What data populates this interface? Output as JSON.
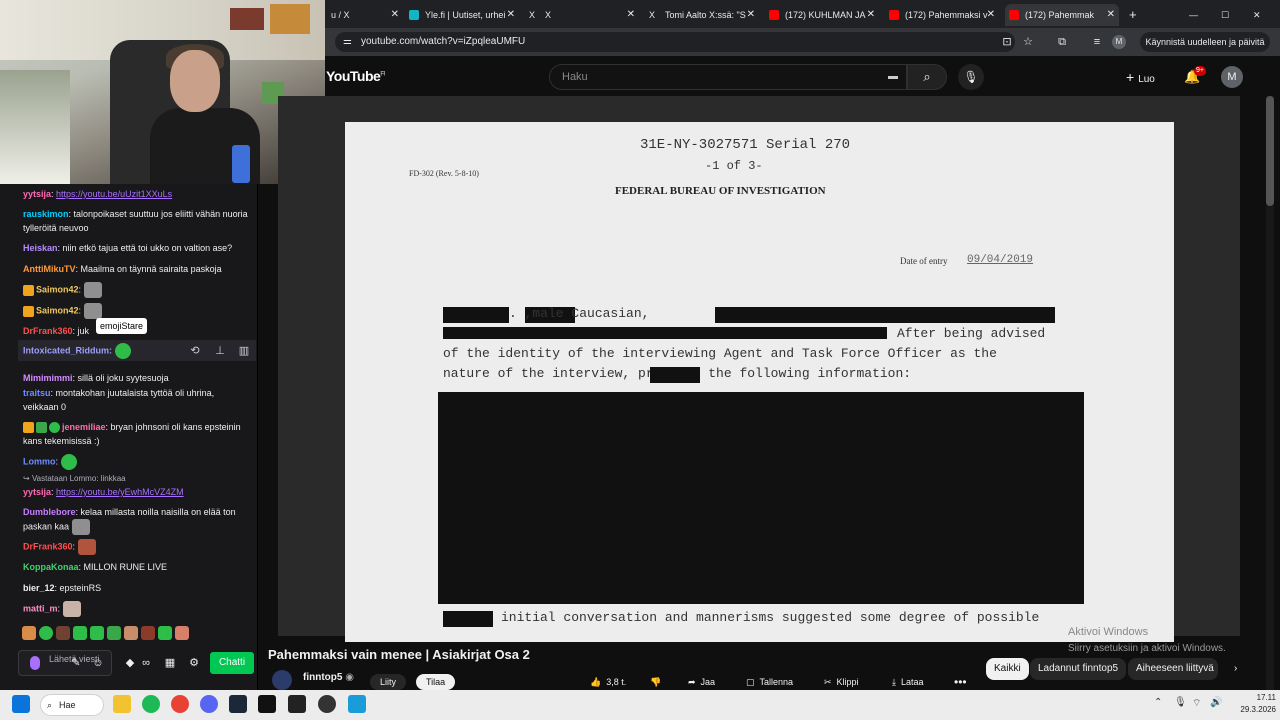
{
  "browser": {
    "tabs": [
      {
        "label": "u / X",
        "icon": "x-icon"
      },
      {
        "label": "Yle.fi | Uutiset, urhei",
        "icon": "yle-icon"
      },
      {
        "label": "X",
        "icon": "x-icon"
      },
      {
        "label": "Tomi Aalto X:ssä: \"S",
        "icon": "x-icon"
      },
      {
        "label": "(172) KUHLMAN JA",
        "icon": "youtube-icon"
      },
      {
        "label": "(172) Pahemmaksi v",
        "icon": "youtube-icon"
      },
      {
        "label": "(172) Pahemmak",
        "icon": "youtube-icon",
        "active": true
      }
    ],
    "url": "youtube.com/watch?v=iZpqleaUMFU",
    "relaunch_label": "Käynnistä uudelleen ja päivitä",
    "profile_initial": "M"
  },
  "youtube": {
    "logo": "YouTube",
    "logo_region": "FI",
    "search_placeholder": "Haku",
    "create_label": "Luo",
    "notifications": "9+",
    "avatar_initial": "M",
    "video_title": "Pahemmaksi vain menee | Asiakirjat Osa 2",
    "channel": "finntop5",
    "join_label": "Liity",
    "subscribe_label": "Tilaa",
    "likes": "3,8 t.",
    "share_label": "Jaa",
    "save_label": "Tallenna",
    "clip_label": "Klippi",
    "download_label": "Lataa",
    "chips": [
      "Kaikki",
      "Ladannut finntop5",
      "Aiheeseen liittyvä"
    ],
    "watermark_title": "Aktivoi Windows",
    "watermark_sub": "Siirry asetuksiin ja aktivoi Windows."
  },
  "document": {
    "serial": "31E-NY-3027571 Serial 270",
    "page": "-1 of 3-",
    "form": "FD-302 (Rev. 5-8-10)",
    "agency": "FEDERAL BUREAU OF INVESTIGATION",
    "date_label": "Date of entry",
    "date_value": "09/04/2019",
    "line1": ".        ,male Caucasian,",
    "line2": "After being advised",
    "line3": "of the identity of the interviewing Agent and Task Force Officer as the",
    "line4": "nature of the interview,        provided the following information:",
    "line5": "initial conversation and mannerisms suggested some degree of possible"
  },
  "chat": {
    "messages": [
      {
        "user": "yytsija",
        "color": "#ff69b4",
        "text": "https://youtu.be/uUzit1XXuLs",
        "link": true
      },
      {
        "user": "rauskimon",
        "color": "#00d1ff",
        "text": "talonpoikaset suuttuu jos eliitti vähän nuoria tylleröitä neuvoo"
      },
      {
        "user": "Heiskan",
        "color": "#b48cff",
        "text": "niin etkö tajua että toi ukko on valtion ase?"
      },
      {
        "user": "AnttiMikuTV",
        "color": "#ff9a3c",
        "text": "Maailma on täynnä sairaita paskoja"
      },
      {
        "user": "Saimon42",
        "color": "#f0c75e",
        "text": ""
      },
      {
        "user": "Saimon42",
        "color": "#f0c75e",
        "text": ""
      },
      {
        "user": "DrFrank360",
        "color": "#ff4f4f",
        "text": "juk"
      },
      {
        "user": "Intoxicated_Riddum",
        "color": "#9e9eff",
        "text": ""
      },
      {
        "user": "Mimimimmi",
        "color": "#d28cff",
        "text": "sillä oli joku syytesuoja"
      },
      {
        "user": "traitsu",
        "color": "#6f8cff",
        "text": "montakohan juutalaista tyttöä oli uhrina, veikkaan 0"
      },
      {
        "user": "jenemiliae",
        "color": "#ff6ea8",
        "text": "bryan johnsoni oli kans epsteinin kans tekemisissä :)"
      },
      {
        "user": "Lommo",
        "color": "#6f8cff",
        "text": ""
      },
      {
        "user": "yytsija",
        "color": "#ff69b4",
        "text": "https://youtu.be/yEwhMcVZ4ZM",
        "link": true
      },
      {
        "user": "Dumblebore",
        "color": "#c77dff",
        "text": "kelaa millasta noilla naisilla on elää ton paskan kaa"
      },
      {
        "user": "DrFrank360",
        "color": "#ff4f4f",
        "text": ""
      },
      {
        "user": "KoppaKonaa",
        "color": "#3cd46a",
        "text": "MILLON RUNE LIVE"
      },
      {
        "user": "bier_12",
        "color": "#efeff1",
        "text": "epsteinRS"
      },
      {
        "user": "matti_m",
        "color": "#ff8cc8",
        "text": ""
      }
    ],
    "reply_hint": "Vastataan Lommo: linkkaa",
    "tooltip": "emojiStare",
    "input_placeholder": "Lähetä viesti",
    "send_label": "Chatti"
  },
  "taskbar": {
    "search_label": "Hae",
    "time": "17.11",
    "date": "29.3.2026"
  }
}
